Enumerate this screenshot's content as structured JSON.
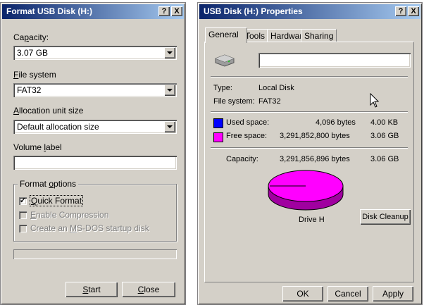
{
  "format_dialog": {
    "title": "Format USB Disk (H:)",
    "help_btn": "?",
    "close_btn": "X",
    "capacity_label": "Capacity:",
    "capacity_value": "3.07 GB",
    "filesystem_label": "File system",
    "filesystem_value": "FAT32",
    "allocation_label": "Allocation unit size",
    "allocation_value": "Default allocation size",
    "volume_label": "Volume label",
    "volume_value": "",
    "options_title": "Format options",
    "quick_format": "Quick Format",
    "quick_format_checked": true,
    "enable_compression": "Enable Compression",
    "msdos_startup": "Create an MS-DOS startup disk",
    "start_btn": "Start",
    "close_button": "Close"
  },
  "properties_dialog": {
    "title": "USB Disk (H:) Properties",
    "help_btn": "?",
    "close_btn": "X",
    "tabs": [
      "General",
      "Tools",
      "Hardware",
      "Sharing"
    ],
    "active_tab": "General",
    "drive_name_value": "",
    "type_label": "Type:",
    "type_value": "Local Disk",
    "fs_label": "File system:",
    "fs_value": "FAT32",
    "used_label": "Used space:",
    "used_bytes": "4,096 bytes",
    "used_size": "4.00 KB",
    "used_color": "#0000ff",
    "free_label": "Free space:",
    "free_bytes": "3,291,852,800 bytes",
    "free_size": "3.06 GB",
    "free_color": "#ff00ff",
    "capacity_label": "Capacity:",
    "capacity_bytes": "3,291,856,896 bytes",
    "capacity_size": "3.06 GB",
    "drive_label": "Drive H",
    "disk_cleanup_btn": "Disk Cleanup",
    "ok_btn": "OK",
    "cancel_btn": "Cancel",
    "apply_btn": "Apply"
  }
}
